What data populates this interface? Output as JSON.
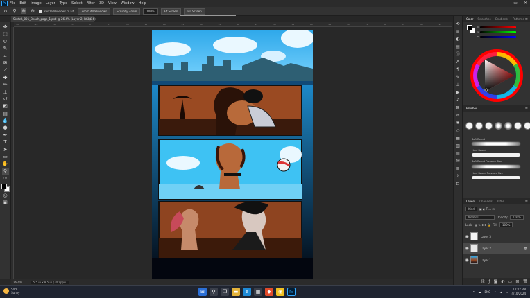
{
  "app": {
    "logo": "Ps"
  },
  "menu": [
    "File",
    "Edit",
    "Image",
    "Layer",
    "Type",
    "Select",
    "Filter",
    "3D",
    "View",
    "Window",
    "Help"
  ],
  "window_controls": [
    "–",
    "▭",
    "✕"
  ],
  "options": {
    "resize_windows_label": "Resize Windows to Fit",
    "zoom_all_windows": "Zoom All Windows",
    "scrubby_zoom": "Scrubby Zoom",
    "zoom_value": "100%",
    "fit_screen": "Fit Screen",
    "fill_screen": "Fill Screen",
    "tooltip": "Zoom current window to screen size"
  },
  "document_tab": {
    "title": "Sketch_001_Beach_page_1.psd @ 26.4% (Layer 2, RGB/16)",
    "close": "×"
  },
  "ruler_ticks": [
    "-20",
    "-15",
    "-10",
    "-5",
    "0",
    "5",
    "10",
    "15",
    "20",
    "25",
    "30",
    "35",
    "40",
    "45",
    "50",
    "55",
    "60",
    "65",
    "70",
    "75",
    "80",
    "85",
    "90",
    "95"
  ],
  "status": {
    "zoom": "26.4%",
    "doc_info": "5.5 in x 8.5 in (300 ppi)"
  },
  "color_panel": {
    "tabs": [
      "Color",
      "Swatches",
      "Gradients",
      "Patterns"
    ],
    "active_tab": "Color",
    "slider_labels": [
      "R",
      "G",
      "B"
    ]
  },
  "brushes_panel": {
    "title": "Brushes",
    "items": [
      "Soft Round",
      "Hard Round",
      "Soft Round Pressure Size",
      "Hard Round Pressure Size"
    ]
  },
  "layers_panel": {
    "tabs": [
      "Layers",
      "Channels",
      "Paths"
    ],
    "active_tab": "Layers",
    "filter_label": "Kind",
    "blend_mode": "Normal",
    "opacity_label": "Opacity:",
    "opacity_value": "100%",
    "lock_label": "Lock:",
    "fill_label": "Fill:",
    "fill_value": "100%",
    "layers": [
      {
        "name": "Layer 3",
        "selected": false
      },
      {
        "name": "Layer 2",
        "selected": true
      },
      {
        "name": "Layer 1",
        "selected": false
      }
    ]
  },
  "taskbar": {
    "weather_temp": "54°F",
    "weather_desc": "Sunny",
    "language": "ENG",
    "time": "11:22 PM",
    "date": "4/10/2024"
  },
  "colors": {
    "accent": "#31a8ff",
    "sky": "#3fb8ee",
    "panel_brown": "#9a4a22"
  }
}
